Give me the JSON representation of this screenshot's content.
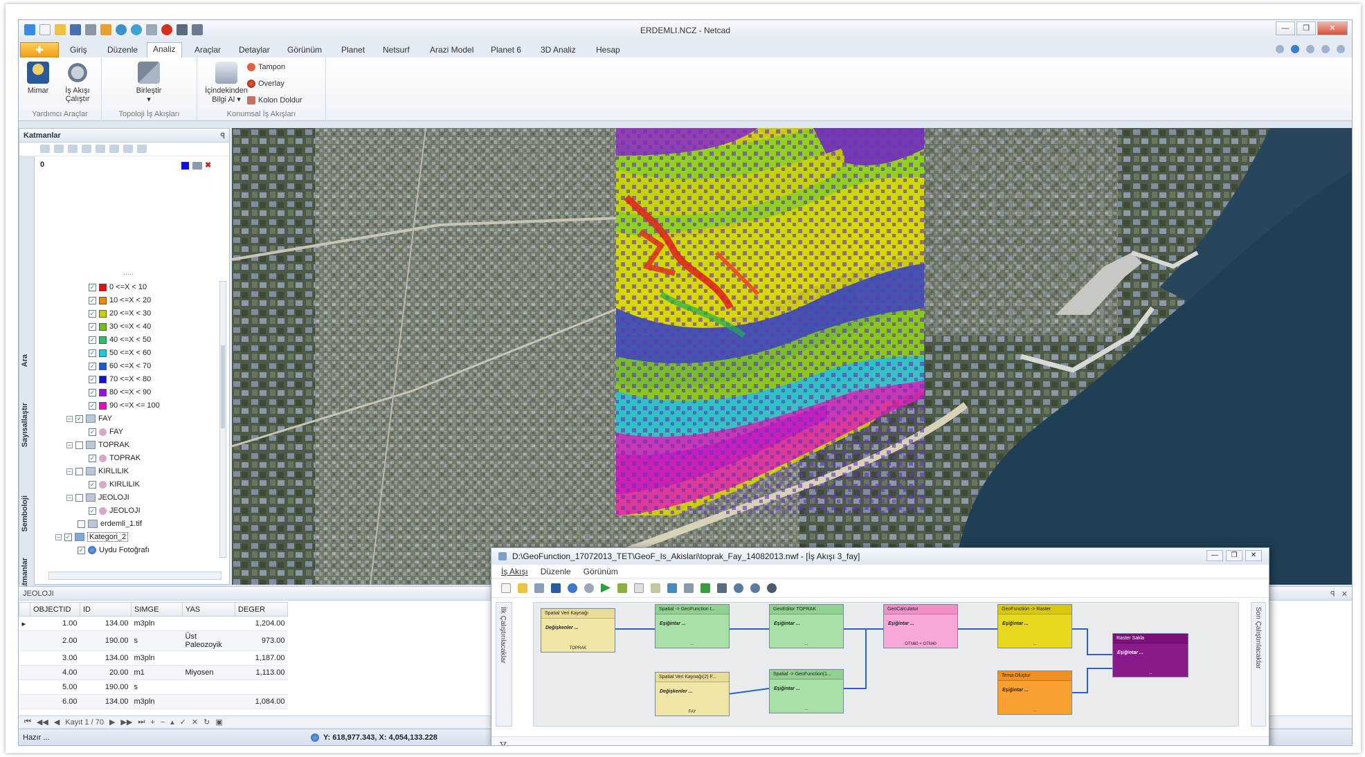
{
  "window": {
    "title": "ERDEMLI.NCZ - Netcad"
  },
  "tabs": [
    "Giriş",
    "Düzenle",
    "Analiz",
    "Araçlar",
    "Detaylar",
    "Görünüm",
    "Planet",
    "Netsurf",
    "Arazi Model",
    "Planet 6",
    "3D Analiz",
    "Hesap"
  ],
  "ribbon": {
    "mimar": "Mimar",
    "is_akisi_1": "İş Akışı",
    "is_akisi_2": "Çalıştır",
    "birlestir": "Birleştir",
    "icindekinden_1": "İçindekinden",
    "icindekinden_2": "Bilgi Al ▾",
    "tampon": "Tampon",
    "overlay": "Overlay",
    "kolon_doldur": "Kolon Doldur",
    "group1": "Yardımcı Araçlar",
    "group2": "Topoloji İş Akışları",
    "group3": "Konumsal İş Akışları"
  },
  "layers_panel": {
    "title": "Katmanlar",
    "top_item": "0",
    "vtabs": [
      "Ara",
      "Sayısallaştır",
      "Semboloji",
      "Katmanlar"
    ],
    "legend": [
      {
        "label": "0 <=X < 10",
        "color": "#e01010"
      },
      {
        "label": "10 <=X < 20",
        "color": "#f08a00"
      },
      {
        "label": "20 <=X < 30",
        "color": "#c8d400"
      },
      {
        "label": "30 <=X < 40",
        "color": "#6cc024"
      },
      {
        "label": "40 <=X < 50",
        "color": "#2ec066"
      },
      {
        "label": "50 <=X < 60",
        "color": "#20c8e0"
      },
      {
        "label": "60 <=X < 70",
        "color": "#1a58d8"
      },
      {
        "label": "70 <=X < 80",
        "color": "#1a10c8"
      },
      {
        "label": "80 <=X < 90",
        "color": "#9a10d8"
      },
      {
        "label": "90 <=X <= 100",
        "color": "#e010c0"
      }
    ],
    "groups": [
      {
        "name": "FAY",
        "child": "FAY"
      },
      {
        "name": "TOPRAK",
        "child": "TOPRAK"
      },
      {
        "name": "KIRLILIK",
        "child": "KIRLILIK"
      },
      {
        "name": "JEOLOJI",
        "child": "JEOLOJI"
      }
    ],
    "raster": "erdemli_1.tif",
    "category": "Kategori_2",
    "photo": "Uydu Fotoğrafı"
  },
  "table": {
    "title": "JEOLOJI",
    "columns": [
      "OBJECTID",
      "ID",
      "SIMGE",
      "YAS",
      "DEGER"
    ],
    "rows": [
      [
        "1.00",
        "134.00",
        "m3pln",
        "",
        "1,204.00"
      ],
      [
        "2.00",
        "190.00",
        "s",
        "Üst Paleozoyik",
        "973.00"
      ],
      [
        "3.00",
        "134.00",
        "m3pln",
        "",
        "1,187.00"
      ],
      [
        "4.00",
        "20.00",
        "m1",
        "Miyosen",
        "1,113.00"
      ],
      [
        "5.00",
        "190.00",
        "s",
        "",
        ""
      ],
      [
        "6.00",
        "134.00",
        "m3pln",
        "",
        "1,084.00"
      ]
    ],
    "record": "Kayıt 1 / 70"
  },
  "status": {
    "ready": "Hazır ...",
    "coords": "Y: 618,977.343, X: 4,054,133.228"
  },
  "workflow": {
    "title": "D:\\GeoFunction_17072013_TET\\GeoF_Is_Akislari\\toprak_Fay_14082013.nwf - [İş Akışı 3_fay]",
    "menu": [
      "İş Akışı",
      "Düzenle",
      "Görünüm"
    ],
    "left_tab": "İlk Çalıştırılacaklar",
    "right_tab": "Son Çalıştırılacaklar",
    "nodes": {
      "n1_title": "Spatial Veri Kaynağı",
      "n1_body": "Değişkenler ...",
      "n1_foot": "TOPRAK",
      "n2_title": "Spatial -> GeoFunction t...",
      "n2_body": "Eşiğintar ...",
      "n2_foot": "...",
      "n3_title": "GeoEditor TOPRAK",
      "n3_body": "Eşiğintar ...",
      "n3_foot": "...",
      "n4_title": "GeoCalculator",
      "n4_body": "Eşiğintar ...",
      "n4_foot": "OTN60 + OTN40",
      "n5_title": "GeoFunction -> Raster",
      "n5_body": "Eşiğintar ...",
      "n5_foot": "...",
      "n6_title": "Spatial Veri Kaynağı(2) F...",
      "n6_body": "Değişkenler ...",
      "n6_foot": "FAY",
      "n7_title": "Spatial -> GeoFunction(1...",
      "n7_body": "Eşiğintar ...",
      "n7_foot": "...",
      "n8_title": "Tema Oluştur",
      "n8_body": "Eşiğintar ...",
      "n8_foot": "...",
      "n9_title": "Raster Sakla",
      "n9_body": "Eşiğintar ...",
      "n9_foot": "..."
    }
  }
}
